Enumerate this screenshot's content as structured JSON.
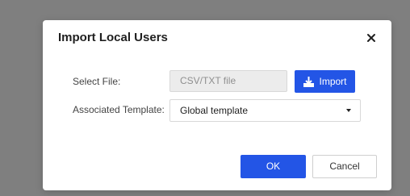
{
  "dialog": {
    "title": "Import Local Users",
    "close_icon": "close-icon"
  },
  "form": {
    "select_file_label": "Select File:",
    "file_placeholder": "CSV/TXT file",
    "import_button_label": "Import",
    "import_icon": "import-icon",
    "template_label": "Associated Template:",
    "template_selected": "Global template"
  },
  "footer": {
    "ok_label": "OK",
    "cancel_label": "Cancel"
  },
  "colors": {
    "primary": "#2355e6",
    "backdrop": "#7f7f7f"
  }
}
